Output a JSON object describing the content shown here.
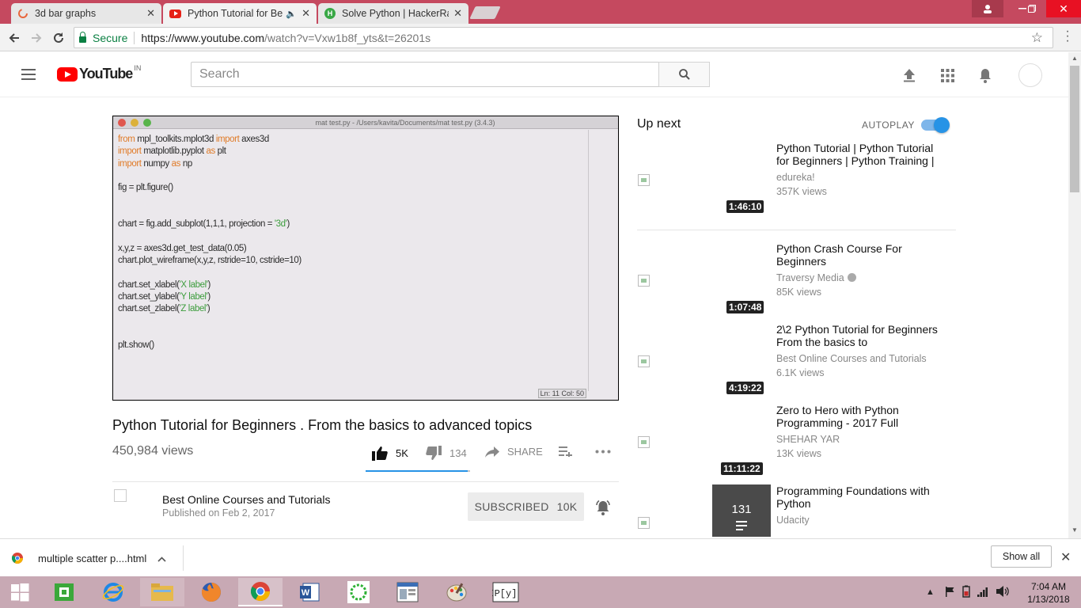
{
  "browser": {
    "tabs": [
      {
        "title": "3d bar graphs",
        "favicon": "loading-spinner-icon"
      },
      {
        "title": "Python Tutorial for Be",
        "favicon": "youtube-icon",
        "audio": true
      },
      {
        "title": "Solve Python | HackerRa",
        "favicon": "hackerrank-icon"
      }
    ],
    "address": {
      "secure_label": "Secure",
      "url_host": "https://www.youtube.com",
      "url_rest": "/watch?v=Vxw1b8f_yts&t=26201s"
    }
  },
  "youtube": {
    "logo_text": "YouTube",
    "region": "IN",
    "search_placeholder": "Search"
  },
  "video": {
    "ide_window_title": "mat test.py - /Users/kavita/Documents/mat test.py (3.4.3)",
    "code_lines": [
      [
        {
          "t": "from",
          "c": "kw"
        },
        {
          "t": " mpl_toolkits.mplot3d "
        },
        {
          "t": "import",
          "c": "kw"
        },
        {
          "t": " axes3d"
        }
      ],
      [
        {
          "t": "import",
          "c": "kw"
        },
        {
          "t": " matplotlib.pyplot "
        },
        {
          "t": "as",
          "c": "kw"
        },
        {
          "t": " plt"
        }
      ],
      [
        {
          "t": "import",
          "c": "kw"
        },
        {
          "t": " numpy "
        },
        {
          "t": "as",
          "c": "kw"
        },
        {
          "t": " np"
        }
      ],
      [],
      [
        {
          "t": "fig = plt.figure()"
        }
      ],
      [],
      [],
      [
        {
          "t": "chart = fig.add_subplot(1,1,1, projection = "
        },
        {
          "t": "'3d'",
          "c": "str"
        },
        {
          "t": ")"
        }
      ],
      [],
      [
        {
          "t": "x,y,z = axes3d.get_test_data(0.05)"
        }
      ],
      [
        {
          "t": "chart.plot_wireframe(x,y,z, rstride=10, cstride=10)"
        }
      ],
      [],
      [
        {
          "t": "chart.set_xlabel("
        },
        {
          "t": "'X label'",
          "c": "str"
        },
        {
          "t": ")"
        }
      ],
      [
        {
          "t": "chart.set_ylabel("
        },
        {
          "t": "'Y label'",
          "c": "str"
        },
        {
          "t": ")"
        }
      ],
      [
        {
          "t": "chart.set_zlabel("
        },
        {
          "t": "'Z label'",
          "c": "str"
        },
        {
          "t": ")"
        }
      ],
      [],
      [],
      [
        {
          "t": "plt.show()"
        }
      ]
    ],
    "ide_status": "Ln: 11  Col: 50",
    "title": "Python Tutorial for Beginners . From the basics to advanced topics",
    "views": "450,984 views",
    "likes": "5K",
    "dislikes": "134",
    "share_label": "SHARE",
    "like_ratio": 0.974,
    "channel": "Best Online Courses and Tutorials",
    "published": "Published on Feb 2, 2017",
    "subscribed_label": "SUBSCRIBED",
    "subscriber_count": "10K"
  },
  "sidebar": {
    "up_next_label": "Up next",
    "autoplay_label": "AUTOPLAY",
    "autoplay_on": true,
    "items": [
      {
        "title": "Python Tutorial | Python Tutorial for Beginners | Python Training |",
        "channel": "edureka!",
        "views": "357K views",
        "duration": "1:46:10"
      },
      {
        "title": "Python Crash Course For Beginners",
        "channel": "Traversy Media",
        "views": "85K views",
        "duration": "1:07:48",
        "verified": true
      },
      {
        "title": "2\\2 Python Tutorial for Beginners From the basics to",
        "channel": "Best Online Courses and Tutorials",
        "views": "6.1K views",
        "duration": "4:19:22"
      },
      {
        "title": "Zero to Hero with Python Programming - 2017 Full",
        "channel": "SHEHAR YAR",
        "views": "13K views",
        "duration": "11:11:22"
      },
      {
        "title": "Programming Foundations with Python",
        "channel": "Udacity",
        "playlist_count": "131"
      }
    ]
  },
  "download_bar": {
    "file": "multiple scatter p....html",
    "show_all": "Show all"
  },
  "taskbar": {
    "time": "7:04 AM",
    "date": "1/13/2018",
    "apps": [
      "file-manager-icon",
      "internet-explorer-icon",
      "file-explorer-icon",
      "firefox-icon",
      "chrome-icon",
      "word-icon",
      "green-ring-app-icon",
      "window-app-icon",
      "paint-icon",
      "ipython-icon"
    ]
  },
  "colors": {
    "tabstrip": "#c5495f",
    "youtube_red": "#ff0000",
    "accent_blue": "#2793e6",
    "taskbar": "#c8a9b4"
  }
}
